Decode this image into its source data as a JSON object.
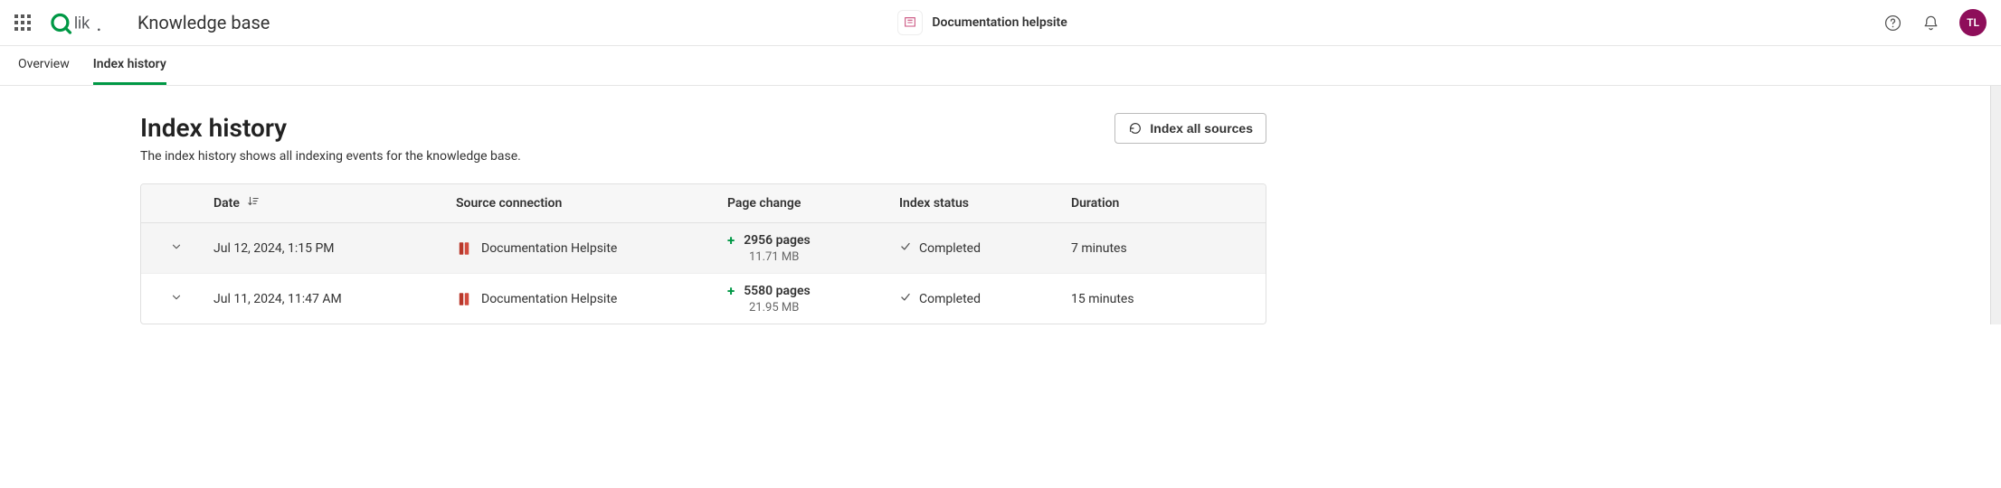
{
  "header": {
    "app_title": "Knowledge base",
    "center_label": "Documentation helpsite",
    "avatar_initials": "TL"
  },
  "tabs": {
    "overview": "Overview",
    "index_history": "Index history"
  },
  "page": {
    "title": "Index history",
    "description": "The index history shows all indexing events for the knowledge base.",
    "index_button": "Index all sources"
  },
  "table": {
    "headers": {
      "date": "Date",
      "source": "Source connection",
      "page_change": "Page change",
      "status": "Index status",
      "duration": "Duration"
    },
    "rows": [
      {
        "date": "Jul 12, 2024, 1:15 PM",
        "source": "Documentation Helpsite",
        "pages": "2956 pages",
        "size": "11.71 MB",
        "status": "Completed",
        "duration": "7 minutes"
      },
      {
        "date": "Jul 11, 2024, 11:47 AM",
        "source": "Documentation Helpsite",
        "pages": "5580 pages",
        "size": "21.95 MB",
        "status": "Completed",
        "duration": "15 minutes"
      }
    ]
  }
}
